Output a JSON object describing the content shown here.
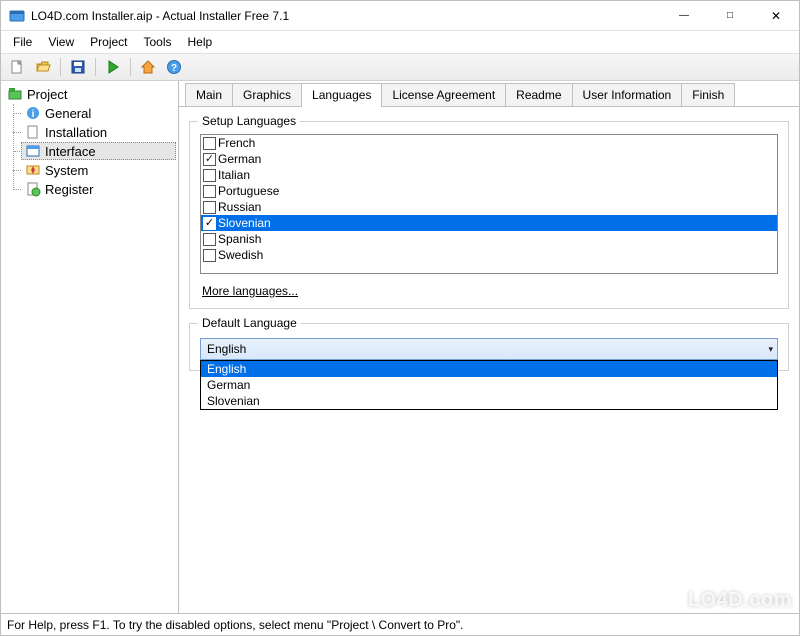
{
  "window": {
    "title": "LO4D.com Installer.aip - Actual Installer Free 7.1"
  },
  "menu": {
    "items": [
      "File",
      "View",
      "Project",
      "Tools",
      "Help"
    ]
  },
  "toolbar": {
    "new": "new",
    "open": "open",
    "save": "save",
    "run": "run",
    "home": "home",
    "help": "help"
  },
  "tree": {
    "root": "Project",
    "items": [
      {
        "label": "General",
        "selected": false
      },
      {
        "label": "Installation",
        "selected": false
      },
      {
        "label": "Interface",
        "selected": true
      },
      {
        "label": "System",
        "selected": false
      },
      {
        "label": "Register",
        "selected": false
      }
    ]
  },
  "tabs": {
    "items": [
      "Main",
      "Graphics",
      "Languages",
      "License Agreement",
      "Readme",
      "User Information",
      "Finish"
    ],
    "active": "Languages"
  },
  "setup_languages": {
    "legend": "Setup Languages",
    "rows": [
      {
        "label": "French",
        "checked": false,
        "selected": false
      },
      {
        "label": "German",
        "checked": true,
        "selected": false
      },
      {
        "label": "Italian",
        "checked": false,
        "selected": false
      },
      {
        "label": "Portuguese",
        "checked": false,
        "selected": false
      },
      {
        "label": "Russian",
        "checked": false,
        "selected": false
      },
      {
        "label": "Slovenian",
        "checked": true,
        "selected": true
      },
      {
        "label": "Spanish",
        "checked": false,
        "selected": false
      },
      {
        "label": "Swedish",
        "checked": false,
        "selected": false
      }
    ],
    "more_link": "More languages..."
  },
  "default_language": {
    "legend": "Default Language",
    "selected": "English",
    "options": [
      {
        "label": "English",
        "selected": true
      },
      {
        "label": "German",
        "selected": false
      },
      {
        "label": "Slovenian",
        "selected": false
      }
    ]
  },
  "statusbar": {
    "text": "For Help, press F1.  To try the disabled options, select menu \"Project \\ Convert to Pro\"."
  },
  "watermark": {
    "text": "LO4D.com"
  }
}
